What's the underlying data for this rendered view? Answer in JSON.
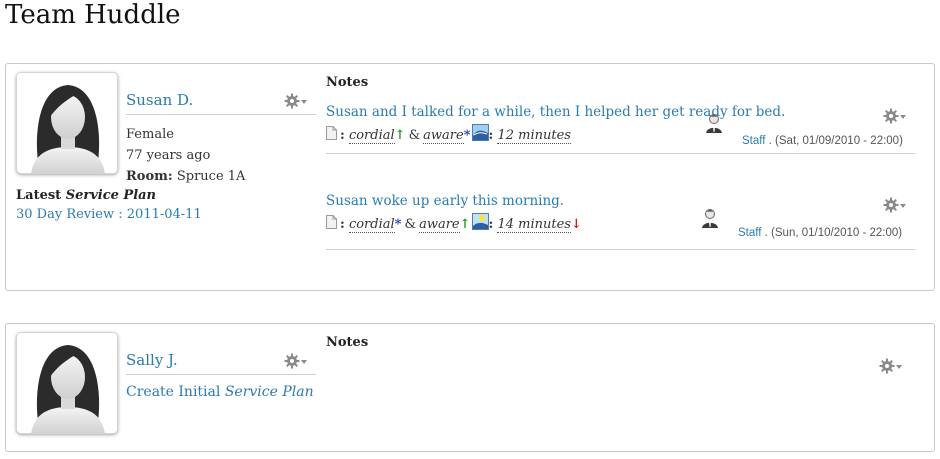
{
  "page": {
    "title": "Team Huddle"
  },
  "residents": [
    {
      "name": "Susan D.",
      "gender": "Female",
      "age": "77 years ago",
      "room_label": "Room:",
      "room": "Spruce 1A",
      "plan_prefix": "Latest ",
      "plan_word": "Service Plan",
      "plan_link": "30 Day Review : 2011-04-11",
      "notes_heading": "Notes",
      "notes": [
        {
          "text": "Susan and I talked for a while, then I helped her get ready for bed.",
          "tag1": "cordial",
          "tag1_mark": "↑",
          "amp": "&",
          "tag2": "aware",
          "tag2_mark": "*",
          "duration": "12 minutes",
          "duration_mark": "",
          "staff": "Staff",
          "timestamp": ". (Sat, 01/09/2010 - 22:00)"
        },
        {
          "text": "Susan woke up early this morning.",
          "tag1": "cordial",
          "tag1_mark": "*",
          "amp": "&",
          "tag2": "aware",
          "tag2_mark": "↑",
          "duration": "14 minutes",
          "duration_mark": "↓",
          "staff": "Staff",
          "timestamp": ". (Sun, 01/10/2010 - 22:00)"
        }
      ]
    },
    {
      "name": "Sally J.",
      "create_prefix": "Create Initial ",
      "create_word": "Service Plan",
      "notes_heading": "Notes"
    }
  ],
  "colors": {
    "link": "#2a7bb0",
    "up": "#2a9a2a",
    "down": "#c62020",
    "star": "#1f3fc6"
  },
  "icons": {
    "gear": "gear-icon",
    "document": "document-icon",
    "mood": "mood-wave-icon",
    "staff": "staff-avatar-icon"
  }
}
